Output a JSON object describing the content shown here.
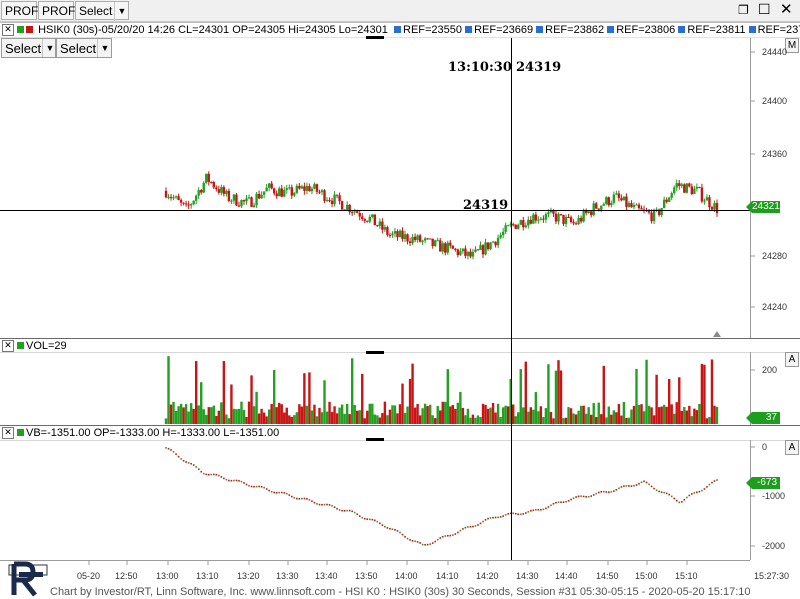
{
  "toolbar": {
    "prof1": "PROF",
    "prof2": "PROF",
    "select": "Select"
  },
  "price_pane": {
    "header": "HSIK0 (30s)-05/20/20 14:26 CL=24301 OP=24305 Hi=24305 Lo=24301",
    "refs": [
      "REF=23550",
      "REF=23669",
      "REF=23862",
      "REF=23806",
      "REF=23811",
      "REF=237"
    ],
    "select1": "Select",
    "select2": "Select",
    "side_button": "M",
    "crosshair_time": "13:10:30",
    "crosshair_value_top": "24319",
    "crosshair_value_mid": "24319",
    "current_price": "24321",
    "y_ticks": [
      "24440",
      "24400",
      "24360",
      "24320",
      "24280",
      "24240"
    ]
  },
  "volume_pane": {
    "header": "VOL=29",
    "side_button": "A",
    "current_volume": "37",
    "y_ticks": [
      "200",
      "100"
    ]
  },
  "vb_pane": {
    "header": "VB=-1351.00 OP=-1333.00 H=-1333.00 L=-1351.00",
    "side_button": "A",
    "current_value": "-673",
    "y_ticks": [
      "0",
      "-1000",
      "-2000"
    ]
  },
  "x_axis": {
    "ticks": [
      "05-20",
      "12:50",
      "13:00",
      "13:10",
      "13:20",
      "13:30",
      "13:40",
      "13:50",
      "14:00",
      "14:10",
      "14:20",
      "14:30",
      "14:40",
      "14:50",
      "15:00",
      "15:10"
    ],
    "right_label": "15:27:30"
  },
  "footer": "Chart by Investor/RT, Linn Software, Inc. www.linnsoft.com - HSI K0 : HSIK0 (30s) 30 Seconds, Session #31 05:30-05:15 - 2020-05-20 15:17:10",
  "colors": {
    "up": "#22a022",
    "down": "#c81414",
    "tag": "#1e9e1e"
  },
  "chart_data": {
    "type": "line",
    "title": "HSIK0 (30s)",
    "xlabel": "",
    "ylabel": "",
    "ylim": [
      24220,
      24450
    ],
    "x": [
      "13:00",
      "13:05",
      "13:10",
      "13:15",
      "13:20",
      "13:25",
      "13:30",
      "13:35",
      "13:40",
      "13:45",
      "13:50",
      "13:55",
      "14:00",
      "14:05",
      "14:10",
      "14:15",
      "14:20",
      "14:25",
      "14:30",
      "14:35",
      "14:40",
      "14:45",
      "14:50",
      "14:55",
      "15:00",
      "15:05",
      "15:10",
      "15:15"
    ],
    "series": [
      {
        "name": "Close",
        "values": [
          24335,
          24320,
          24345,
          24330,
          24325,
          24337,
          24333,
          24338,
          24330,
          24322,
          24313,
          24300,
          24298,
          24293,
          24289,
          24283,
          24295,
          24308,
          24315,
          24315,
          24309,
          24322,
          24330,
          24320,
          24315,
          24340,
          24335,
          24321
        ]
      }
    ]
  }
}
